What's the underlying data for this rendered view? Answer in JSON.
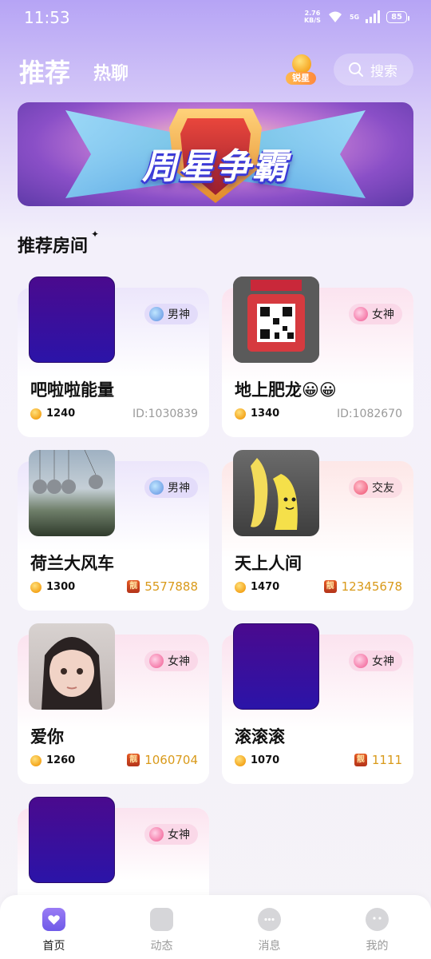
{
  "status_bar": {
    "time": "11:53",
    "net_speed_value": "2.76",
    "net_speed_unit": "KB/S",
    "signal": "5G",
    "battery": "85"
  },
  "header": {
    "tab_recommend": "推荐",
    "tab_hot_chat": "热聊",
    "star_badge": "锐星",
    "search_label": "搜索"
  },
  "banner": {
    "title": "周星争霸"
  },
  "section": {
    "title": "推荐房间"
  },
  "rooms": [
    {
      "name": "吧啦啦能量",
      "tag": "男神",
      "heat": "1240",
      "id_text": "ID:1030839"
    },
    {
      "name": "地上肥龙😀😀",
      "tag": "女神",
      "heat": "1340",
      "id_text": "ID:1082670"
    },
    {
      "name": "荷兰大风车",
      "tag": "男神",
      "heat": "1300",
      "pretty_id": "5577888",
      "pretty_tag": "靓"
    },
    {
      "name": "天上人间",
      "tag": "交友",
      "heat": "1470",
      "pretty_id": "12345678",
      "pretty_tag": "靓"
    },
    {
      "name": "爱你",
      "tag": "女神",
      "heat": "1260",
      "pretty_id": "1060704",
      "pretty_tag": "靓"
    },
    {
      "name": "滚滚滚",
      "tag": "女神",
      "heat": "1070",
      "pretty_id": "1111",
      "pretty_tag": "靓"
    },
    {
      "tag": "女神"
    }
  ],
  "tabbar": {
    "home": "首页",
    "moments": "动态",
    "messages": "消息",
    "me": "我的"
  },
  "colors": {
    "accent_purple": "#b6a4f5",
    "pretty_id_gold": "#d99a1a"
  }
}
